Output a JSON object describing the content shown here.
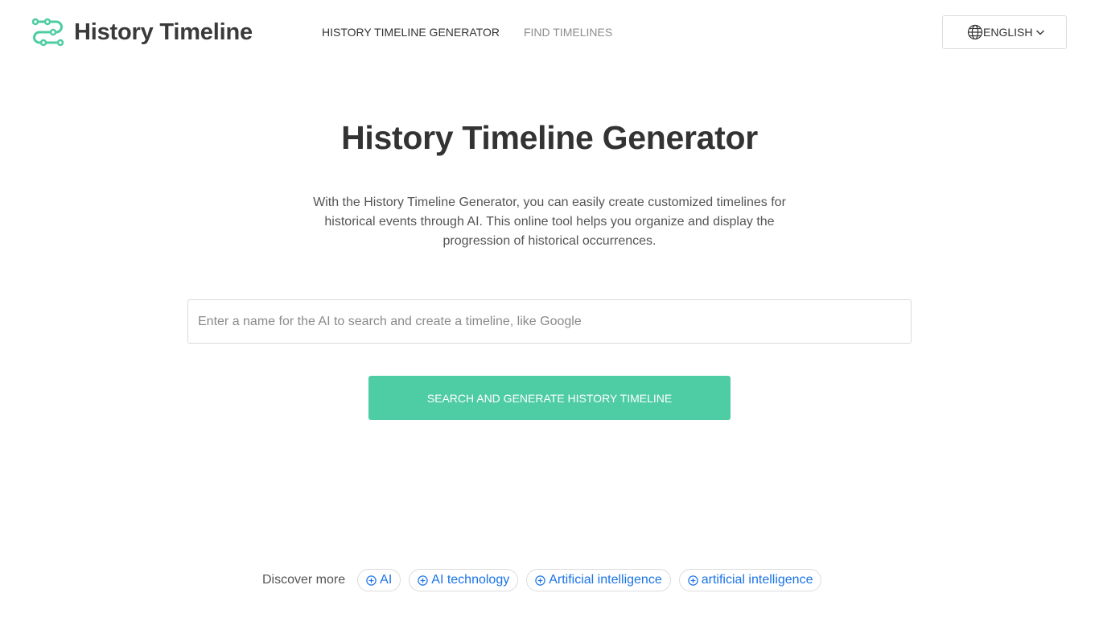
{
  "brand": {
    "name": "History Timeline",
    "accent_color": "#4ecca3",
    "icon": "timeline-logo-icon"
  },
  "nav": {
    "items": [
      {
        "label": "HISTORY TIMELINE GENERATOR",
        "active": true
      },
      {
        "label": "FIND TIMELINES",
        "active": false
      }
    ]
  },
  "language": {
    "label": "ENGLISH",
    "icon": "globe-icon",
    "dropdown_icon": "chevron-down-icon"
  },
  "hero": {
    "title": "History Timeline Generator",
    "description": "With the History Timeline Generator, you can easily create customized timelines for historical events through AI. This online tool helps you organize and display the progression of historical occurrences."
  },
  "search": {
    "placeholder": "Enter a name for the AI to search and create a timeline, like Google",
    "value": ""
  },
  "generate_button": {
    "label": "SEARCH AND GENERATE HISTORY TIMELINE"
  },
  "discover": {
    "label": "Discover more",
    "tags": [
      {
        "label": "AI"
      },
      {
        "label": "AI technology"
      },
      {
        "label": "Artificial intelligence"
      },
      {
        "label": "artificial intelligence"
      }
    ],
    "tag_color": "#1a73e8",
    "tag_icon": "plus-circle-icon"
  }
}
